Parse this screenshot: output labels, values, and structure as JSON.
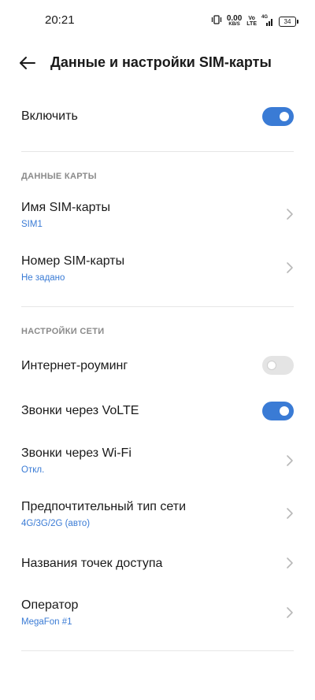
{
  "status_bar": {
    "time": "20:21",
    "speed_value": "0.00",
    "speed_unit": "KB/S",
    "volte_top": "Vo",
    "volte_bottom": "LTE",
    "network": "4G",
    "battery": "34"
  },
  "header": {
    "title": "Данные и настройки SIM-карты"
  },
  "enable_row": {
    "label": "Включить",
    "enabled": true
  },
  "card_section": {
    "heading": "ДАННЫЕ КАРТЫ",
    "sim_name": {
      "label": "Имя SIM-карты",
      "value": "SIM1"
    },
    "sim_number": {
      "label": "Номер SIM-карты",
      "value": "Не задано"
    }
  },
  "network_section": {
    "heading": "НАСТРОЙКИ СЕТИ",
    "roaming": {
      "label": "Интернет-роуминг",
      "enabled": false
    },
    "volte": {
      "label": "Звонки через VoLTE",
      "enabled": true
    },
    "wifi_calls": {
      "label": "Звонки через Wi-Fi",
      "value": "Откл."
    },
    "network_type": {
      "label": "Предпочтительный тип сети",
      "value": "4G/3G/2G (авто)"
    },
    "apn": {
      "label": "Названия точек доступа"
    },
    "operator": {
      "label": "Оператор",
      "value": "MegaFon #1"
    }
  },
  "colors": {
    "accent": "#3a7bd5",
    "section_label": "#8a8a8a",
    "divider": "#e6e6e6"
  }
}
